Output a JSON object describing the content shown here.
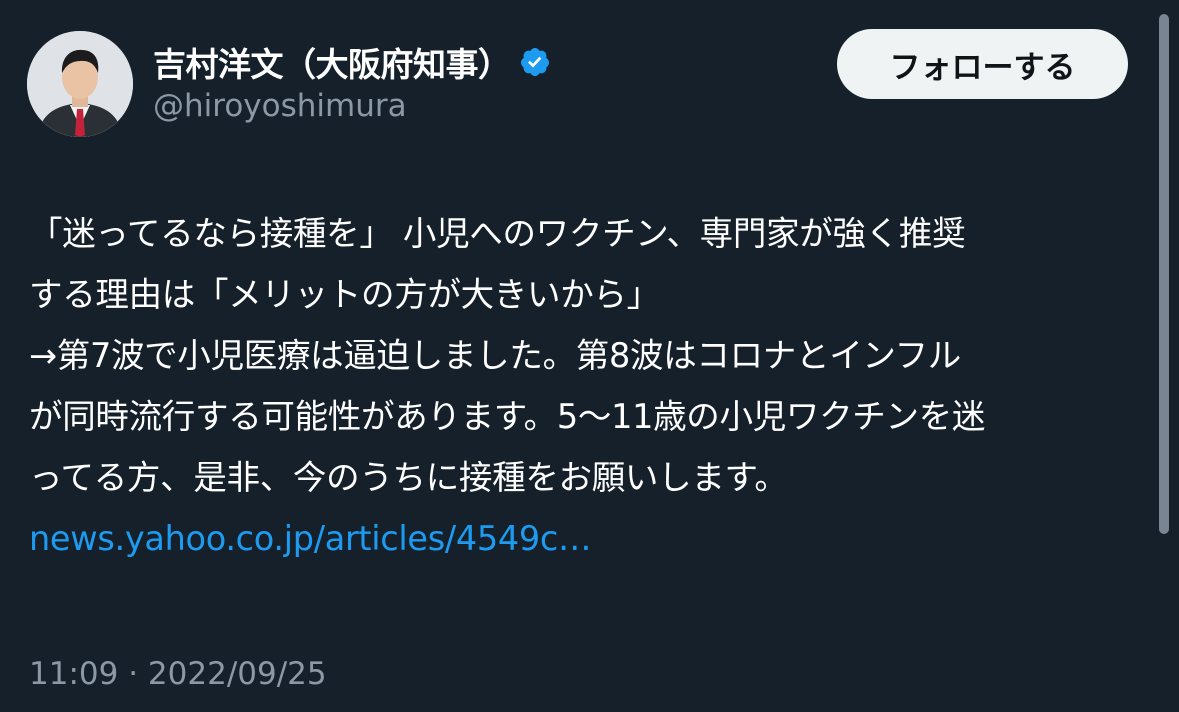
{
  "author": {
    "display_name": "吉村洋文（大阪府知事）",
    "handle": "@hiroyoshimura",
    "verified": true,
    "avatar_icon": "profile-photo"
  },
  "follow_button": {
    "label": "フォローする"
  },
  "tweet": {
    "lines": [
      "「迷ってるなら接種を」 小児へのワクチン、専門家が強く推奨",
      "する理由は「メリットの方が大きいから」",
      "→第7波で小児医療は逼迫しました。第8波はコロナとインフル",
      "が同時流行する可能性があります。5〜11歳の小児ワクチンを迷",
      "ってる方、是非、今のうちに接種をお願いします。"
    ],
    "link": "news.yahoo.co.jp/articles/4549c…"
  },
  "meta": {
    "time": "11:09",
    "separator": "·",
    "date": "2022/09/25"
  },
  "colors": {
    "background": "#15202b",
    "text": "#ffffff",
    "secondary": "#8b98a5",
    "link": "#1d9bf0",
    "verified": "#1d9bf0",
    "button_bg": "#eff3f4"
  }
}
